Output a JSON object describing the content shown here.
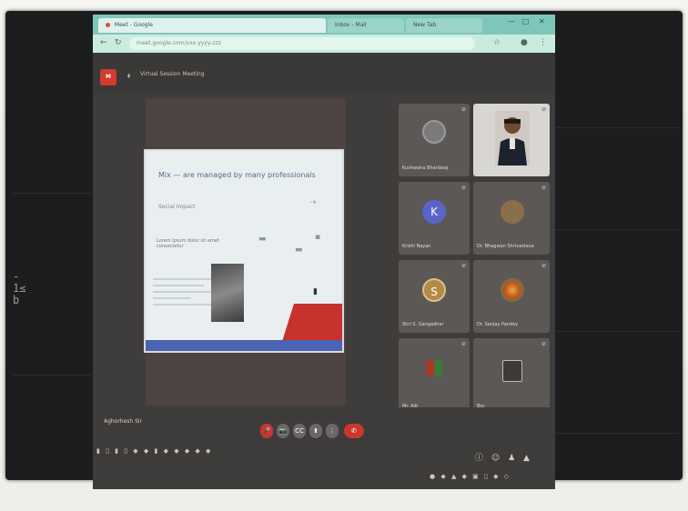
{
  "browser": {
    "tabs": [
      {
        "label": "Meet - Google",
        "active": true
      },
      {
        "label": "Inbox - Mail",
        "active": false
      },
      {
        "label": "New Tab",
        "active": false
      }
    ],
    "url": "meet.google.com/xxx-yyyy-zzz"
  },
  "meeting": {
    "title": "Virtual Session Meeting",
    "slide": {
      "title": "Mix — are managed by many professionals",
      "subtitle": "Social Impact",
      "body": "Lorem ipsum dolor sit amet consectetur"
    },
    "self_name": "Aghorhesh Sir",
    "participants": [
      {
        "name": "Kushwaha Bhardwaj",
        "initial": "",
        "color": "#7a7a7a"
      },
      {
        "name": "",
        "initial": "",
        "color": "#4a4a4a"
      },
      {
        "name": "Krishi Nayan",
        "initial": "K",
        "color": "#5966c7"
      },
      {
        "name": "Dr. Bhagwan Shrivastava",
        "initial": "",
        "color": "#8a6f4a"
      },
      {
        "name": "Shri S. Gangadhar",
        "initial": "S",
        "color": "#b58a46"
      },
      {
        "name": "Dr. Sanjay Pandey",
        "initial": "",
        "color": "#d19a2c"
      },
      {
        "name": "Mr. Ajit",
        "initial": "",
        "color": "#a63a2f"
      },
      {
        "name": "Bsc",
        "initial": "",
        "color": "#3d3a38"
      }
    ]
  },
  "controls": {
    "mic": "🎤",
    "cam": "📷",
    "captions": "CC",
    "present": "⬆",
    "more": "⋮",
    "end": "✆"
  },
  "colors": {
    "accent_red": "#c9382e",
    "tabbar": "#7fc6ba",
    "addressbar": "#c9ecdf"
  }
}
